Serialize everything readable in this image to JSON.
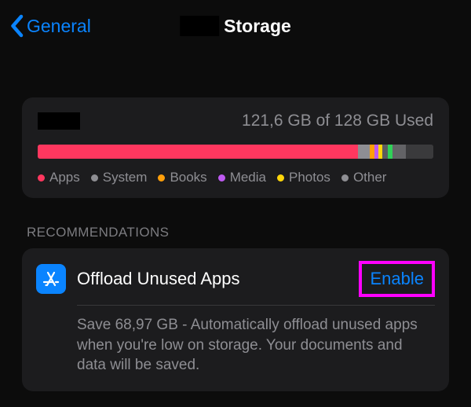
{
  "nav": {
    "back_label": "General",
    "title": "Storage"
  },
  "storage": {
    "used_text": "121,6 GB of 128 GB Used",
    "segments": [
      {
        "name": "Apps",
        "color": "#ff375f",
        "width_pct": 81.0
      },
      {
        "name": "System",
        "color": "#8e8e93",
        "width_pct": 3.0
      },
      {
        "name": "Books",
        "color": "#ff9f0a",
        "width_pct": 1.2
      },
      {
        "name": "Media",
        "color": "#bf5af2",
        "width_pct": 1.0
      },
      {
        "name": "Photos",
        "color": "#ffd60a",
        "width_pct": 1.0
      },
      {
        "name": "Other",
        "color": "#5b5b60",
        "width_pct": 1.2
      },
      {
        "name": "_green",
        "color": "#30d158",
        "width_pct": 1.2
      },
      {
        "name": "_grey",
        "color": "#636366",
        "width_pct": 3.4
      },
      {
        "name": "_free",
        "color": "#3a3a3c",
        "width_pct": 7.0
      }
    ],
    "legend": [
      {
        "label": "Apps",
        "color": "#ff375f"
      },
      {
        "label": "System",
        "color": "#8e8e93"
      },
      {
        "label": "Books",
        "color": "#ff9f0a"
      },
      {
        "label": "Media",
        "color": "#bf5af2"
      },
      {
        "label": "Photos",
        "color": "#ffd60a"
      },
      {
        "label": "Other",
        "color": "#8e8e93"
      }
    ]
  },
  "recommendations": {
    "header": "RECOMMENDATIONS",
    "item": {
      "title": "Offload Unused Apps",
      "action_label": "Enable",
      "description": "Save 68,97 GB - Automatically offload unused apps when you're low on storage. Your documents and data will be saved."
    }
  }
}
